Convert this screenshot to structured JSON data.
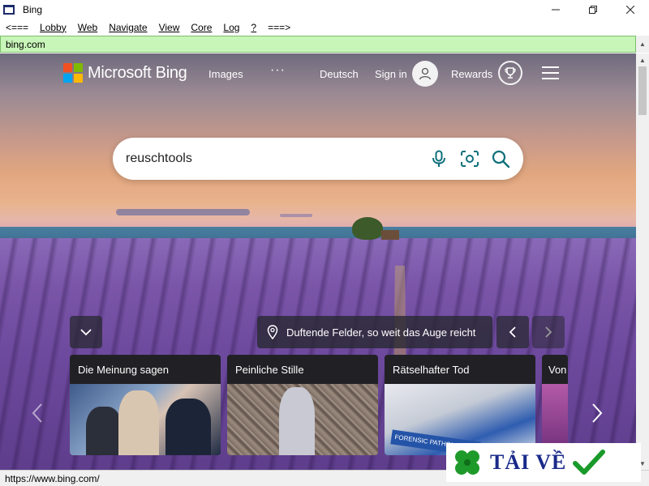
{
  "window": {
    "title": "Bing"
  },
  "menu": {
    "items": [
      "<===",
      "Lobby",
      "Web",
      "Navigate",
      "View",
      "Core",
      "Log",
      "?",
      "===>"
    ]
  },
  "address": {
    "url": "bing.com"
  },
  "bing": {
    "brand": "Microsoft Bing",
    "nav": {
      "images": "Images",
      "more": "···",
      "language": "Deutsch",
      "sign_in": "Sign in",
      "rewards": "Rewards"
    },
    "search": {
      "query": "reuschtools"
    },
    "caption": "Duftende Felder, so weit das Auge reicht",
    "cards": [
      {
        "title": "Die Meinung sagen"
      },
      {
        "title": "Peinliche Stille"
      },
      {
        "title": "Rätselhafter Tod"
      },
      {
        "title": "Von"
      }
    ],
    "card3_overlay": "FORENSIC PATHOL"
  },
  "status": {
    "url": "https://www.bing.com/"
  },
  "watermark": {
    "text": "TẢI VỀ"
  },
  "colors": {
    "address_bg": "#c8f5b8",
    "accent_teal": "#0e6f7a"
  }
}
